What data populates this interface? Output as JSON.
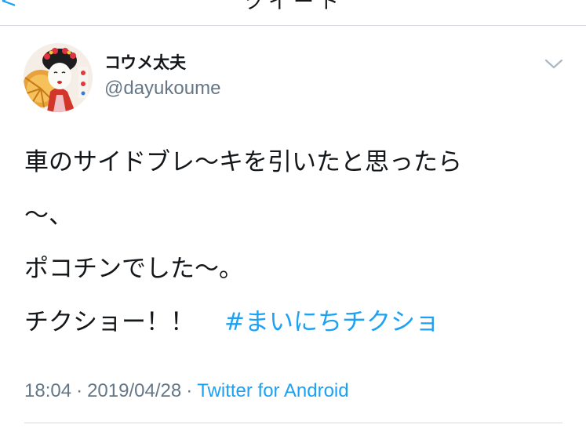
{
  "header": {
    "back_glyph": "<",
    "title_fragment": "ツイート"
  },
  "tweet": {
    "display_name": "コウメ太夫",
    "username": "@dayukoume",
    "avatar_icon": "avatar-photo-icon",
    "menu_icon": "chevron-down-icon",
    "lines": [
      "車のサイドブレ〜キを引いたと思ったら",
      "〜、",
      "ポコチンでした〜。",
      "チクショー！！"
    ],
    "hashtag": "#まいにちチクショ",
    "time": "18:04",
    "separator": "·",
    "date": "2019/04/28",
    "source": "Twitter for Android"
  },
  "colors": {
    "link": "#1da1f2",
    "text": "#14171a",
    "secondary": "#657786",
    "divider": "#d7dbdf"
  }
}
